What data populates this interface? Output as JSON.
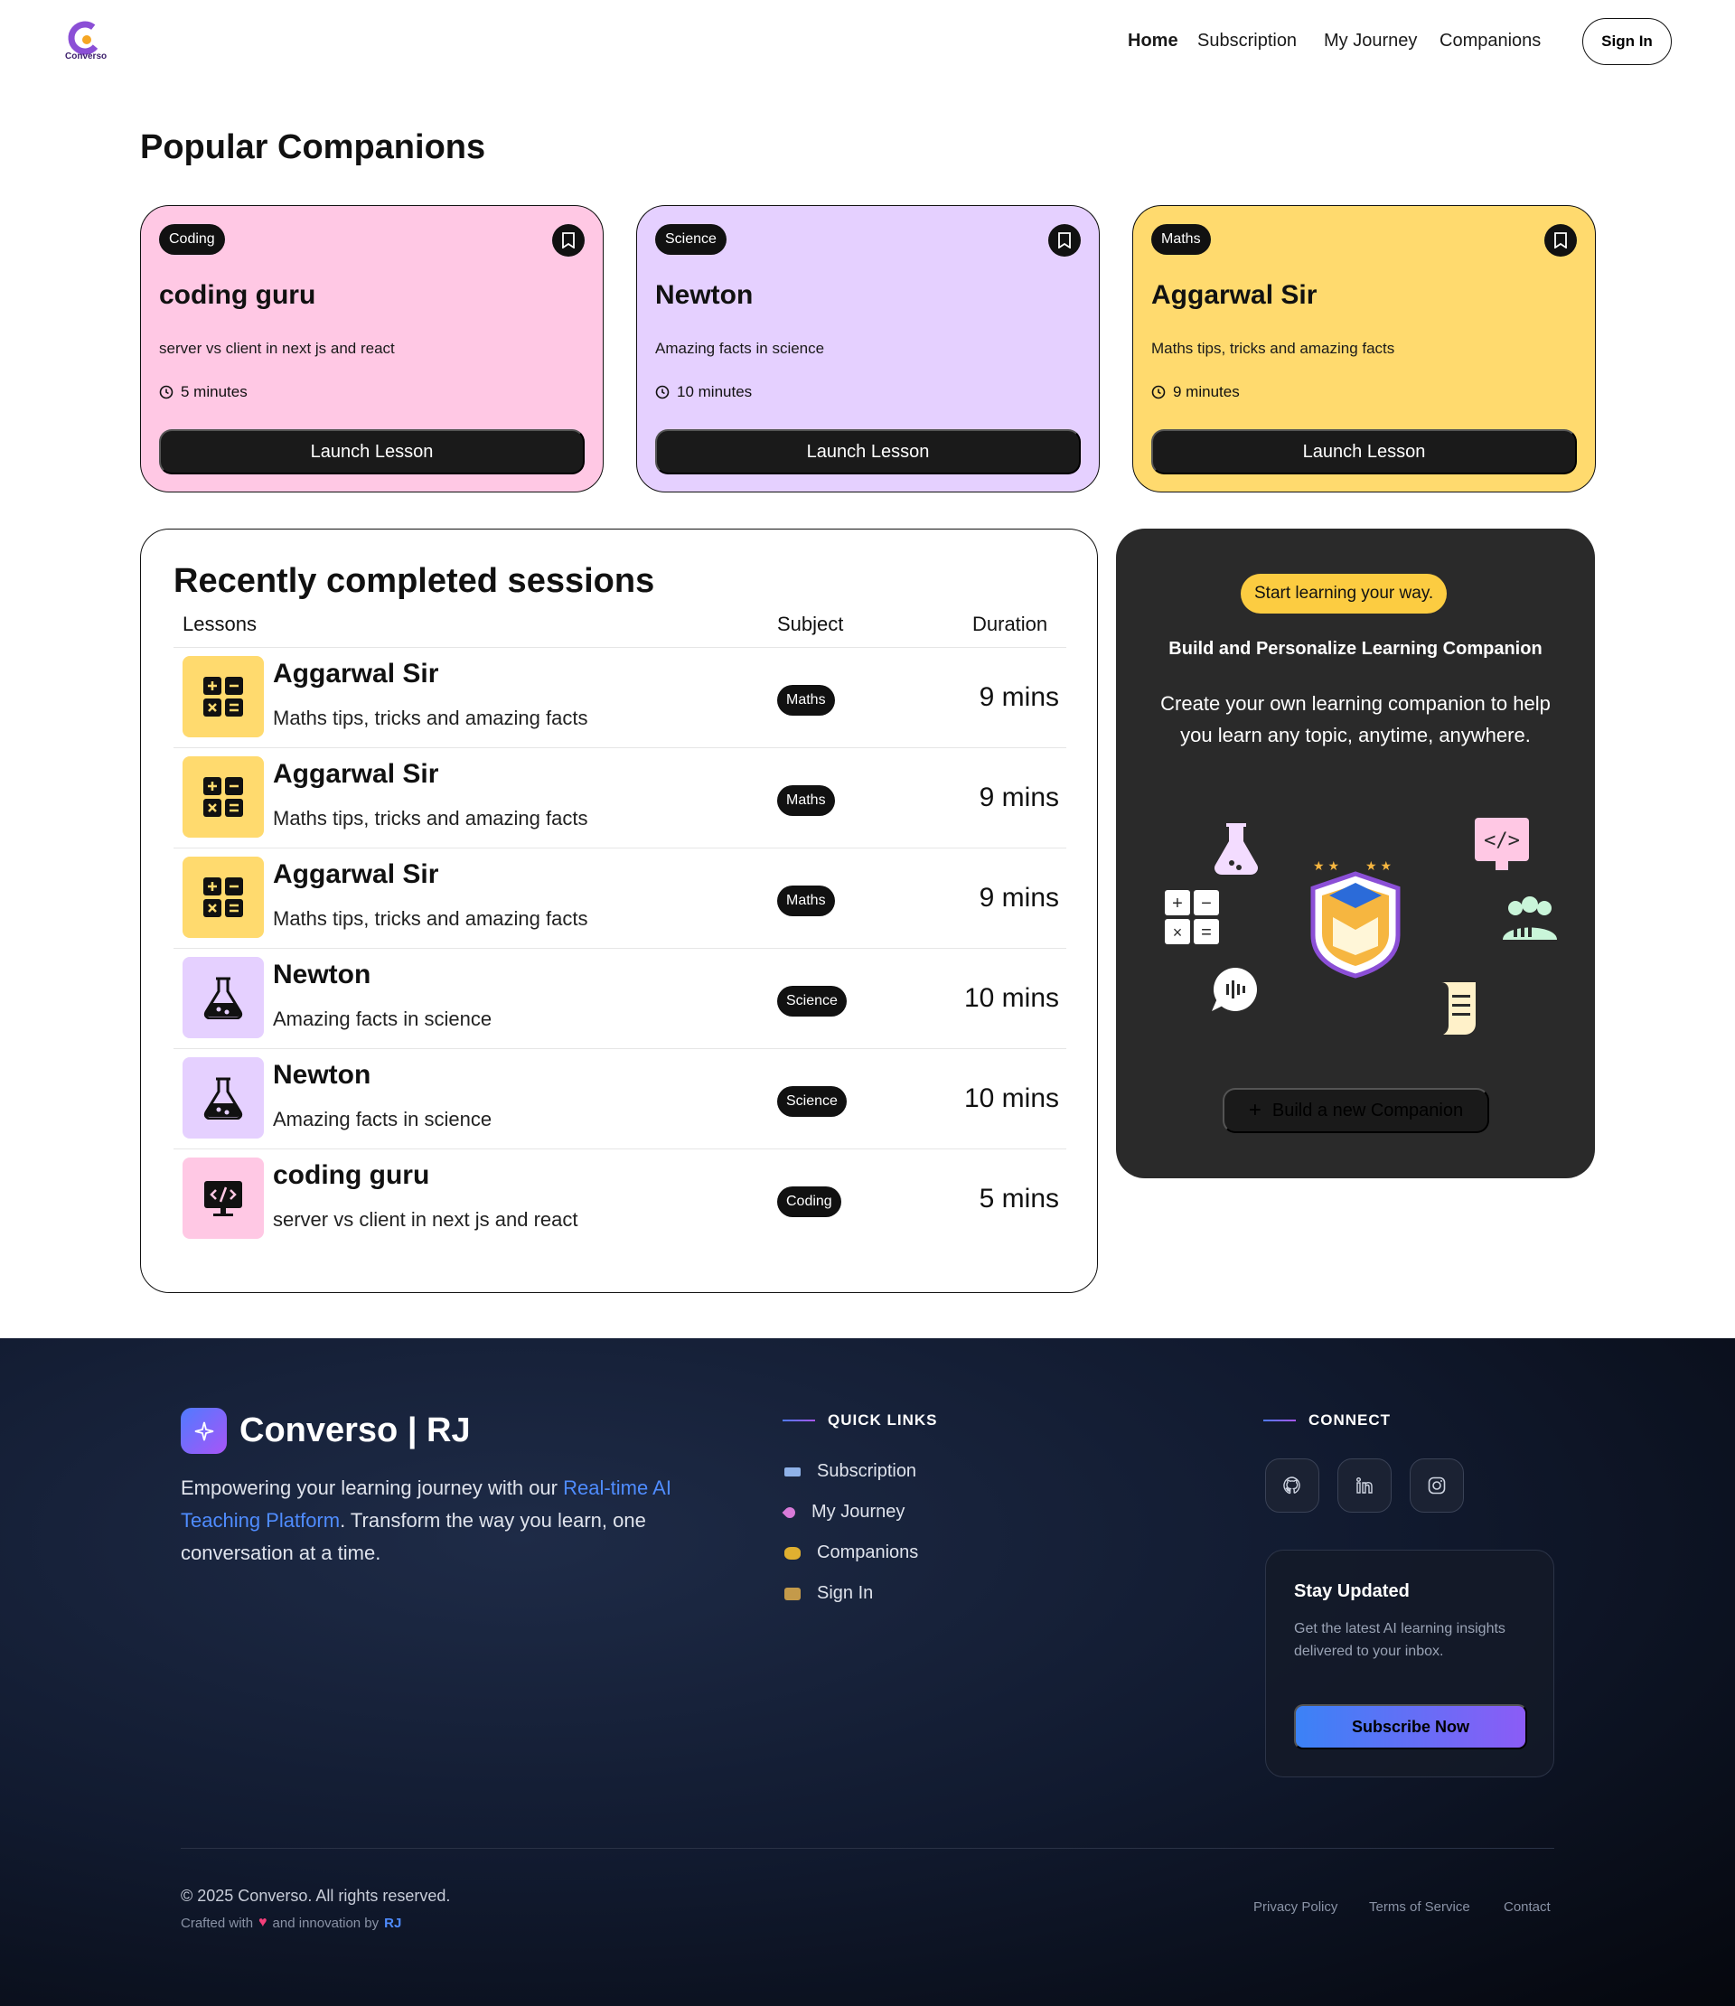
{
  "nav": {
    "logo_text": "Converso",
    "links": [
      "Home",
      "Subscription",
      "My Journey",
      "Companions"
    ],
    "signin": "Sign In"
  },
  "popular": {
    "title": "Popular Companions",
    "cards": [
      {
        "subject": "Coding",
        "name": "coding guru",
        "topic": "server vs client in next js and react",
        "duration": "5 minutes",
        "button": "Launch Lesson",
        "color": "#ffc8e4"
      },
      {
        "subject": "Science",
        "name": "Newton",
        "topic": "Amazing facts in science",
        "duration": "10 minutes",
        "button": "Launch Lesson",
        "color": "#e5d0ff"
      },
      {
        "subject": "Maths",
        "name": "Aggarwal Sir",
        "topic": "Maths tips, tricks and amazing facts",
        "duration": "9 minutes",
        "button": "Launch Lesson",
        "color": "#ffda6e"
      }
    ]
  },
  "recent": {
    "title": "Recently completed sessions",
    "headers": {
      "lessons": "Lessons",
      "subject": "Subject",
      "duration": "Duration"
    },
    "rows": [
      {
        "icon": "calculator-icon",
        "name": "Aggarwal Sir",
        "topic": "Maths tips, tricks and amazing facts",
        "subject": "Maths",
        "duration": "9 mins",
        "color": "#ffda6e"
      },
      {
        "icon": "calculator-icon",
        "name": "Aggarwal Sir",
        "topic": "Maths tips, tricks and amazing facts",
        "subject": "Maths",
        "duration": "9 mins",
        "color": "#ffda6e"
      },
      {
        "icon": "calculator-icon",
        "name": "Aggarwal Sir",
        "topic": "Maths tips, tricks and amazing facts",
        "subject": "Maths",
        "duration": "9 mins",
        "color": "#ffda6e"
      },
      {
        "icon": "flask-icon",
        "name": "Newton",
        "topic": "Amazing facts in science",
        "subject": "Science",
        "duration": "10 mins",
        "color": "#e5d0ff"
      },
      {
        "icon": "flask-icon",
        "name": "Newton",
        "topic": "Amazing facts in science",
        "subject": "Science",
        "duration": "10 mins",
        "color": "#e5d0ff"
      },
      {
        "icon": "code-monitor-icon",
        "name": "coding guru",
        "topic": "server vs client in next js and react",
        "subject": "Coding",
        "duration": "5 mins",
        "color": "#ffc8e4"
      }
    ]
  },
  "cta": {
    "pill": "Start learning your way.",
    "heading": "Build and Personalize Learning Companion",
    "text": "Create your own learning companion to help you learn any topic, anytime, anywhere.",
    "button": "Build a new Companion"
  },
  "footer": {
    "brand": "Converso | RJ",
    "desc_before": "Empowering your learning journey with our ",
    "desc_highlight": "Real-time AI Teaching Platform",
    "desc_after": ". Transform the way you learn, one conversation at a time.",
    "quick_links_title": "QUICK LINKS",
    "quick_links": [
      "Subscription",
      "My Journey",
      "Companions",
      "Sign In"
    ],
    "connect_title": "CONNECT",
    "stay_title": "Stay Updated",
    "stay_desc": "Get the latest AI learning insights delivered to your inbox.",
    "subscribe": "Subscribe Now",
    "copyright": "© 2025 Converso. All rights reserved.",
    "crafted_before": "Crafted with",
    "crafted_after": "and innovation by",
    "crafted_by": "RJ",
    "bottom_links": [
      "Privacy Policy",
      "Terms of Service",
      "Contact"
    ]
  }
}
